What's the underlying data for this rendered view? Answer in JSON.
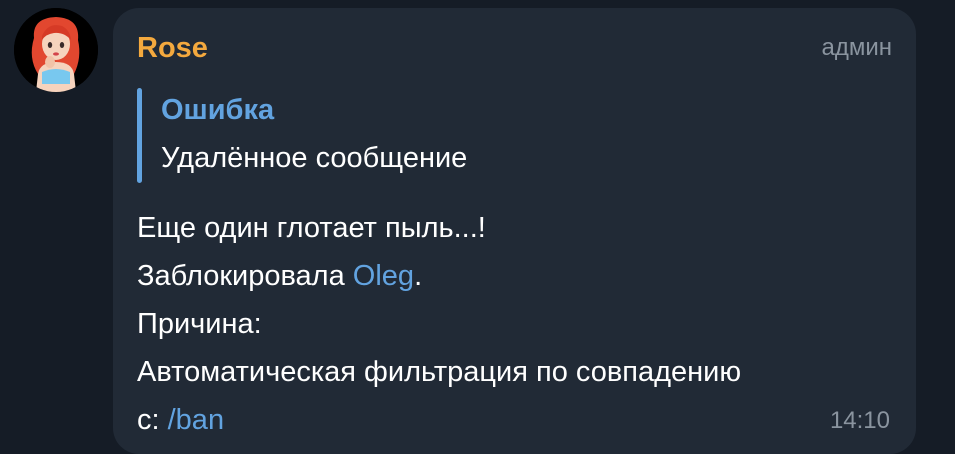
{
  "message": {
    "sender": "Rose",
    "role": "админ",
    "reply": {
      "title": "Ошибка",
      "text": "Удалённое сообщение"
    },
    "body": {
      "line1": "Еще один глотает пыль...!",
      "line2_prefix": "Заблокировала ",
      "mention": "Oleg",
      "line2_suffix": ".",
      "line3": "Причина:",
      "line4": "Автоматическая фильтрация по совпадению",
      "line5_prefix": "с: ",
      "command": "/ban"
    },
    "time": "14:10"
  },
  "colors": {
    "background": "#151c26",
    "bubble": "#212a36",
    "sender": "#f4a93e",
    "link": "#62a3e0",
    "meta": "#8a949f",
    "text": "#ffffff"
  },
  "avatar": {
    "icon": "girl-avatar-icon"
  }
}
